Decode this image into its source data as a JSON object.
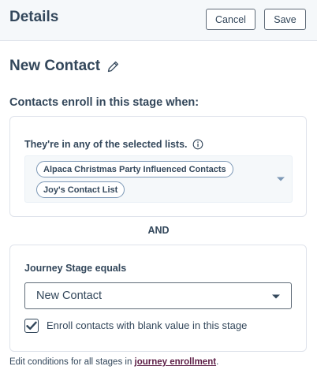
{
  "header": {
    "title": "Details",
    "cancel_label": "Cancel",
    "save_label": "Save"
  },
  "stage": {
    "name": "New Contact",
    "edit_icon": "pencil-icon"
  },
  "section": {
    "heading": "Contacts enroll in this stage when:"
  },
  "list_condition": {
    "label": "They're in any of the selected lists.",
    "info_icon": "info-icon",
    "selected_lists": [
      "Alpaca Christmas Party Influenced Contacts",
      "Joy's Contact List"
    ],
    "dropdown_icon": "caret-down-icon"
  },
  "operator": "AND",
  "property_condition": {
    "label": "Journey Stage equals",
    "selected_value": "New Contact",
    "dropdown_icon": "caret-down-icon",
    "checkbox_checked": true,
    "checkbox_label": "Enroll contacts with blank value in this stage"
  },
  "footer": {
    "text_before": "Edit conditions for all stages in ",
    "link_text": "journey enrollment",
    "text_after": "."
  },
  "colors": {
    "text": "#33475b",
    "header_bg": "#f5f8fa",
    "border": "#dfe3eb",
    "link": "#5c1d45"
  }
}
